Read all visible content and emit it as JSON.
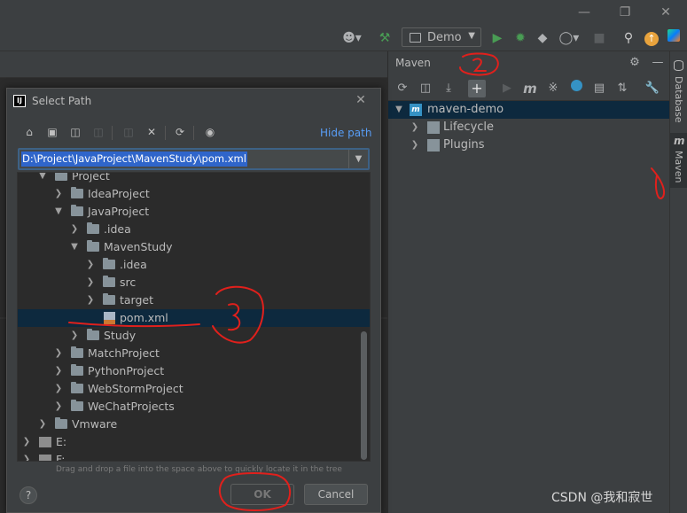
{
  "toolbar": {
    "run_config_label": "Demo"
  },
  "maven": {
    "title": "Maven",
    "tree": [
      {
        "label": "maven-demo",
        "level": 0,
        "expanded": true,
        "selected": true
      },
      {
        "label": "Lifecycle",
        "level": 1,
        "expanded": false
      },
      {
        "label": "Plugins",
        "level": 1,
        "expanded": false
      }
    ]
  },
  "side_tabs": {
    "database": "Database",
    "maven": "Maven"
  },
  "dialog": {
    "title": "Select Path",
    "hide_path_label": "Hide path",
    "path_value": "D:\\Project\\JavaProject\\MavenStudy\\pom.xml",
    "tree": [
      {
        "label": "Project",
        "level": 1,
        "expanded": true,
        "type": "folder"
      },
      {
        "label": "IdeaProject",
        "level": 2,
        "expanded": false,
        "type": "folder"
      },
      {
        "label": "JavaProject",
        "level": 2,
        "expanded": true,
        "type": "folder"
      },
      {
        "label": ".idea",
        "level": 3,
        "expanded": false,
        "type": "folder"
      },
      {
        "label": "MavenStudy",
        "level": 3,
        "expanded": true,
        "type": "folder"
      },
      {
        "label": ".idea",
        "level": 4,
        "expanded": false,
        "type": "folder"
      },
      {
        "label": "src",
        "level": 4,
        "expanded": false,
        "type": "folder"
      },
      {
        "label": "target",
        "level": 4,
        "expanded": false,
        "type": "folder"
      },
      {
        "label": "pom.xml",
        "level": 4,
        "type": "file",
        "selected": true
      },
      {
        "label": "Study",
        "level": 3,
        "expanded": false,
        "type": "folder"
      },
      {
        "label": "MatchProject",
        "level": 2,
        "expanded": false,
        "type": "folder"
      },
      {
        "label": "PythonProject",
        "level": 2,
        "expanded": false,
        "type": "folder"
      },
      {
        "label": "WebStormProject",
        "level": 2,
        "expanded": false,
        "type": "folder"
      },
      {
        "label": "WeChatProjects",
        "level": 2,
        "expanded": false,
        "type": "folder"
      },
      {
        "label": "Vmware",
        "level": 1,
        "expanded": false,
        "type": "folder"
      },
      {
        "label": "E:",
        "level": 0,
        "expanded": false,
        "type": "drive"
      },
      {
        "label": "F:",
        "level": 0,
        "expanded": false,
        "type": "drive"
      }
    ],
    "hint": "Drag and drop a file into the space above to quickly locate it in the tree",
    "help_label": "?",
    "ok_label": "OK",
    "cancel_label": "Cancel"
  },
  "annotations": {
    "mark1": "1",
    "mark2": "2",
    "mark3": "3",
    "color": "#e0201c"
  },
  "watermark": "CSDN @我和寂世",
  "colors": {
    "accent": "#589df6",
    "selection": "#0d293e",
    "run_green": "#499c54"
  }
}
